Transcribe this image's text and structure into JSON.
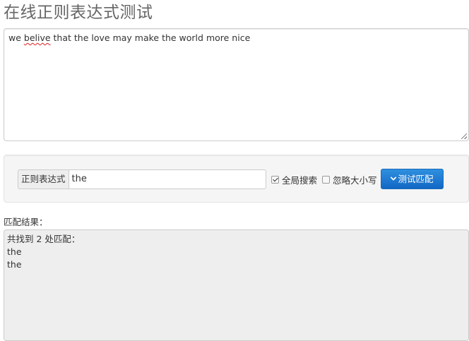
{
  "page": {
    "title": "在线正则表达式测试"
  },
  "source": {
    "text_before": "we ",
    "text_misspelled": "belive",
    "text_after": " that the love may make the world more nice"
  },
  "controls": {
    "regex_label": "正则表达式",
    "regex_value": "the",
    "global_search_label": "全局搜索",
    "global_search_checked": true,
    "ignore_case_label": "忽略大小写",
    "ignore_case_checked": false,
    "test_button_label": "测试匹配",
    "test_button_icon": "chevron-down-icon"
  },
  "result": {
    "label": "匹配结果：",
    "summary": "共找到 2 处匹配：",
    "matches": [
      "the",
      "the"
    ]
  },
  "colors": {
    "button_primary": "#1268c4",
    "result_background": "#eeeeee",
    "panel_background": "#f5f5f5"
  }
}
